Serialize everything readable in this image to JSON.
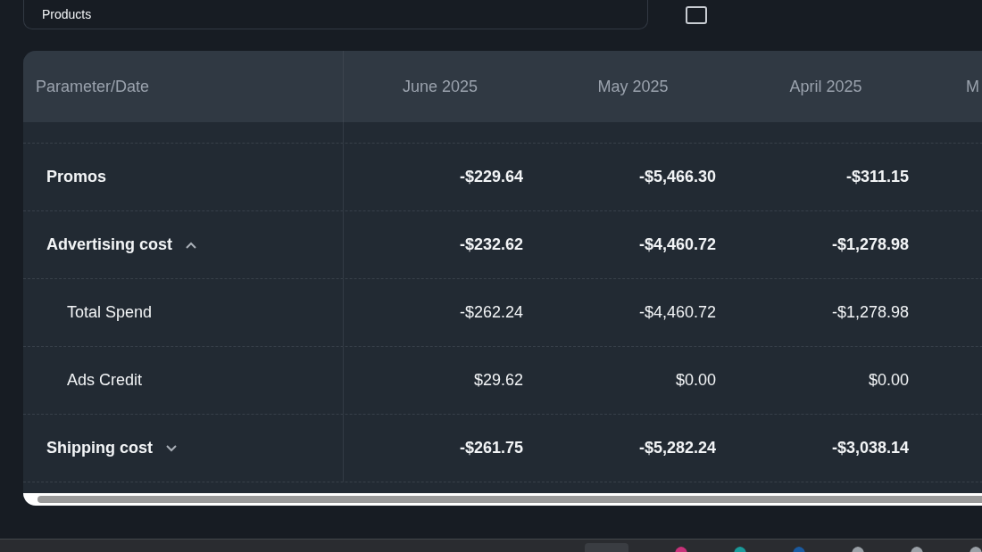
{
  "filter_bar": {
    "products_field": {
      "value": "Products"
    }
  },
  "table": {
    "columns": [
      "Parameter/Date",
      "June 2025",
      "May 2025",
      "April 2025",
      "M"
    ],
    "rows": [
      {
        "label": "Promos",
        "values": [
          "-$229.64",
          "-$5,466.30",
          "-$311.15"
        ]
      },
      {
        "label": "Advertising cost",
        "expanded": true,
        "values": [
          "-$232.62",
          "-$4,460.72",
          "-$1,278.98"
        ],
        "children": [
          {
            "label": "Total Spend",
            "values": [
              "-$262.24",
              "-$4,460.72",
              "-$1,278.98"
            ]
          },
          {
            "label": "Ads Credit",
            "values": [
              "$29.62",
              "$0.00",
              "$0.00"
            ]
          }
        ]
      },
      {
        "label": "Shipping cost",
        "expanded": false,
        "values": [
          "-$261.75",
          "-$5,282.24",
          "-$3,038.14"
        ]
      }
    ]
  }
}
